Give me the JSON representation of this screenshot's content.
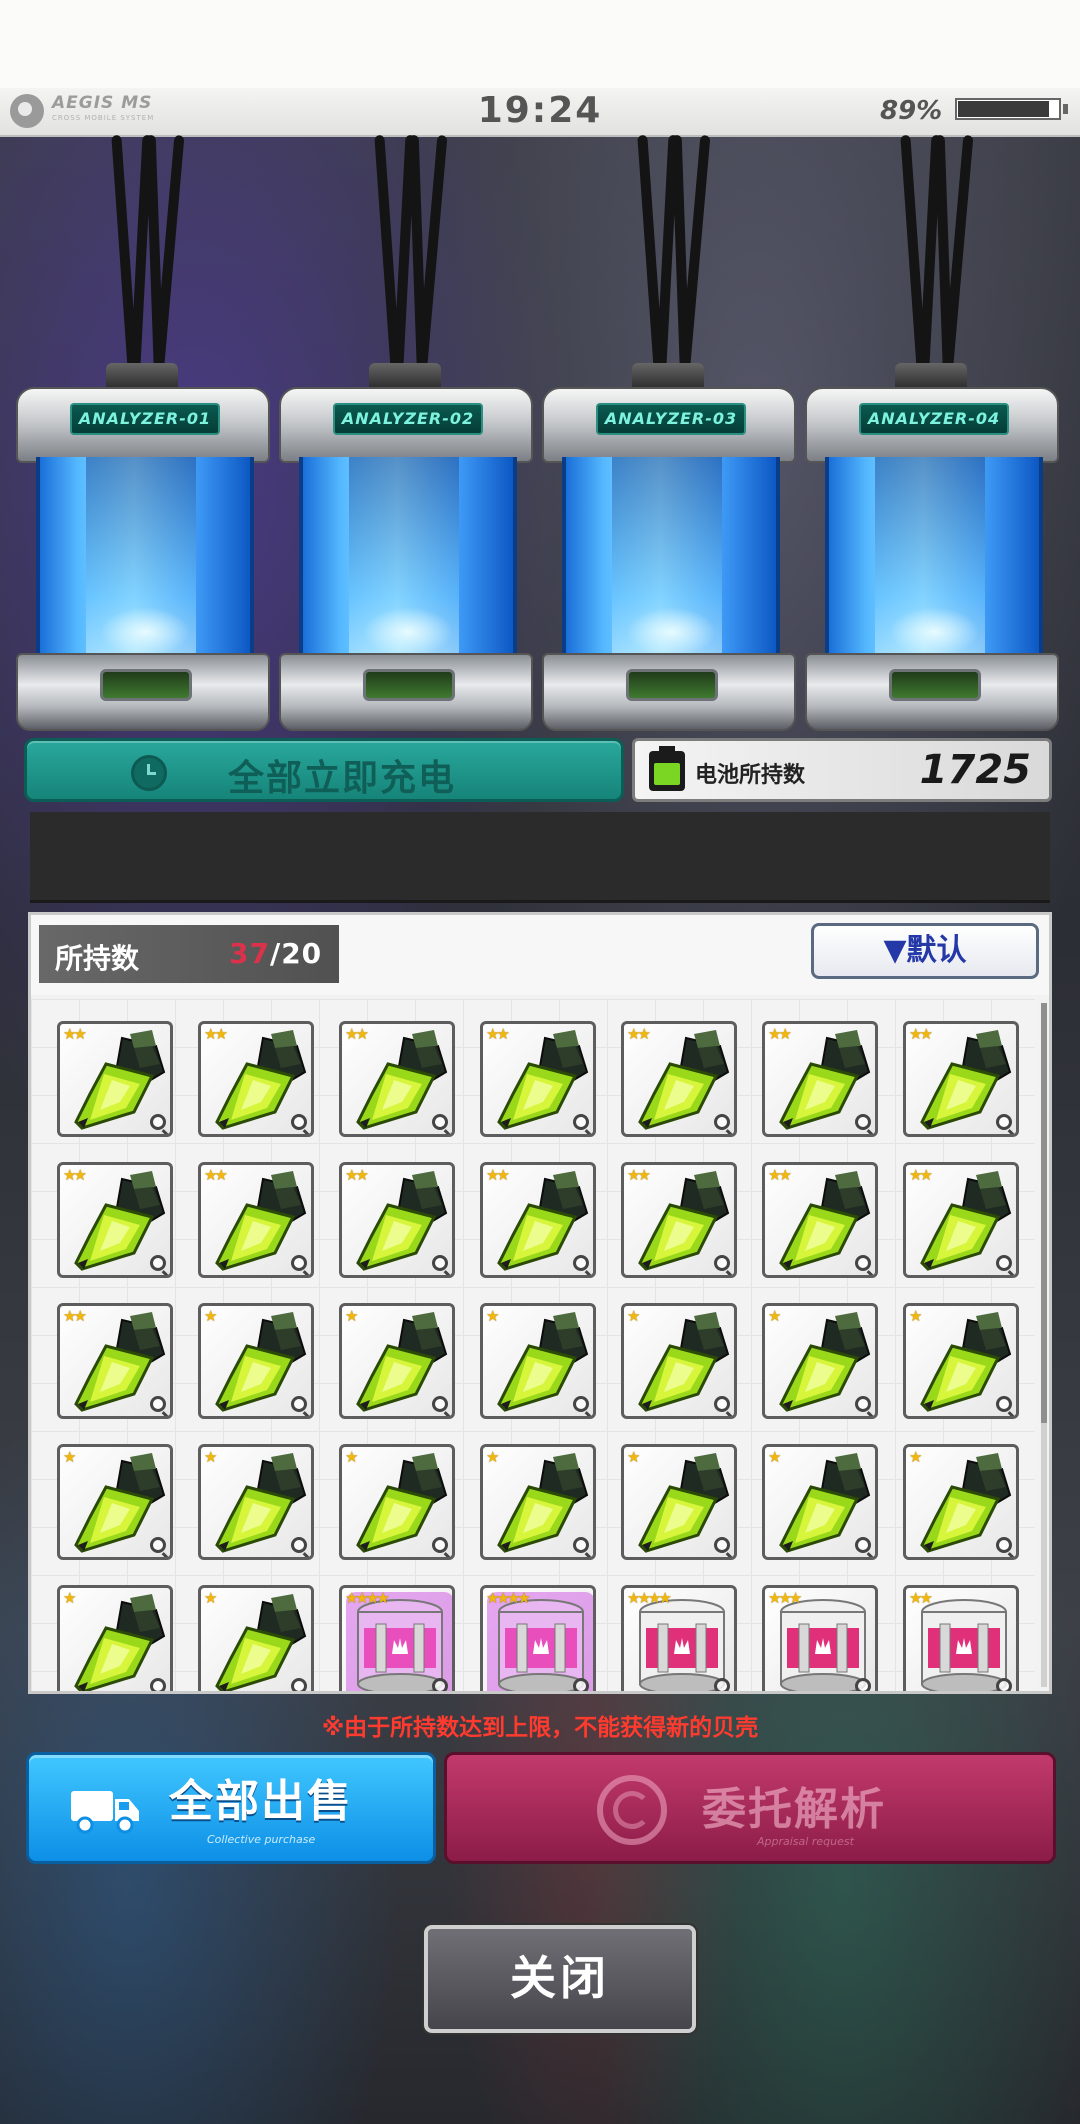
{
  "status_bar": {
    "brand": "AEGIS MS",
    "brand_sub": "CROSS MOBILE SYSTEM",
    "time": "19:24",
    "battery_percent": "89%",
    "battery_level": 0.89
  },
  "analyzers": [
    {
      "label": "ANALYZER-01"
    },
    {
      "label": "ANALYZER-02"
    },
    {
      "label": "ANALYZER-03"
    },
    {
      "label": "ANALYZER-04"
    }
  ],
  "charge_all_label": "全部立即充电",
  "battery_holding": {
    "label": "电池所持数",
    "count": "1725"
  },
  "inventory": {
    "owned_label": "所持数",
    "owned_current": "37",
    "owned_max": "/20",
    "sort_label": "▼默认",
    "items": [
      {
        "stars": "★★",
        "type": "shell-green"
      },
      {
        "stars": "★★",
        "type": "shell-green"
      },
      {
        "stars": "★★",
        "type": "shell-green"
      },
      {
        "stars": "★★",
        "type": "shell-green"
      },
      {
        "stars": "★★",
        "type": "shell-green"
      },
      {
        "stars": "★★",
        "type": "shell-green"
      },
      {
        "stars": "★★",
        "type": "shell-green"
      },
      {
        "stars": "★★",
        "type": "shell-green"
      },
      {
        "stars": "★★",
        "type": "shell-green"
      },
      {
        "stars": "★★",
        "type": "shell-green"
      },
      {
        "stars": "★★",
        "type": "shell-green"
      },
      {
        "stars": "★★",
        "type": "shell-green"
      },
      {
        "stars": "★★",
        "type": "shell-green"
      },
      {
        "stars": "★★",
        "type": "shell-green"
      },
      {
        "stars": "★★",
        "type": "shell-green"
      },
      {
        "stars": "★",
        "type": "shell-green"
      },
      {
        "stars": "★",
        "type": "shell-green"
      },
      {
        "stars": "★",
        "type": "shell-green"
      },
      {
        "stars": "★",
        "type": "shell-green"
      },
      {
        "stars": "★",
        "type": "shell-green"
      },
      {
        "stars": "★",
        "type": "shell-green"
      },
      {
        "stars": "★",
        "type": "shell-green"
      },
      {
        "stars": "★",
        "type": "shell-green"
      },
      {
        "stars": "★",
        "type": "shell-green"
      },
      {
        "stars": "★",
        "type": "shell-green"
      },
      {
        "stars": "★",
        "type": "shell-green"
      },
      {
        "stars": "★",
        "type": "shell-green"
      },
      {
        "stars": "★",
        "type": "shell-green"
      },
      {
        "stars": "★",
        "type": "shell-green"
      },
      {
        "stars": "★",
        "type": "shell-green"
      },
      {
        "stars": "★★★★",
        "type": "box-pink-light"
      },
      {
        "stars": "★★★★",
        "type": "box-pink-light"
      },
      {
        "stars": "★★★★",
        "type": "box-crown"
      },
      {
        "stars": "★★★",
        "type": "box-crown"
      },
      {
        "stars": "★★",
        "type": "box-crown"
      }
    ]
  },
  "warning": "※由于所持数达到上限，不能获得新的贝壳",
  "sell_all": {
    "label": "全部出售",
    "sub": "Collective purchase"
  },
  "appraise": {
    "label": "委托解析",
    "sub": "Appraisal request"
  },
  "close_label": "关闭",
  "colors": {
    "accent_blue": "#1aa3f2",
    "accent_red": "#a82a58",
    "teal": "#1f9a8f",
    "warning_red": "#ff3a2e"
  }
}
